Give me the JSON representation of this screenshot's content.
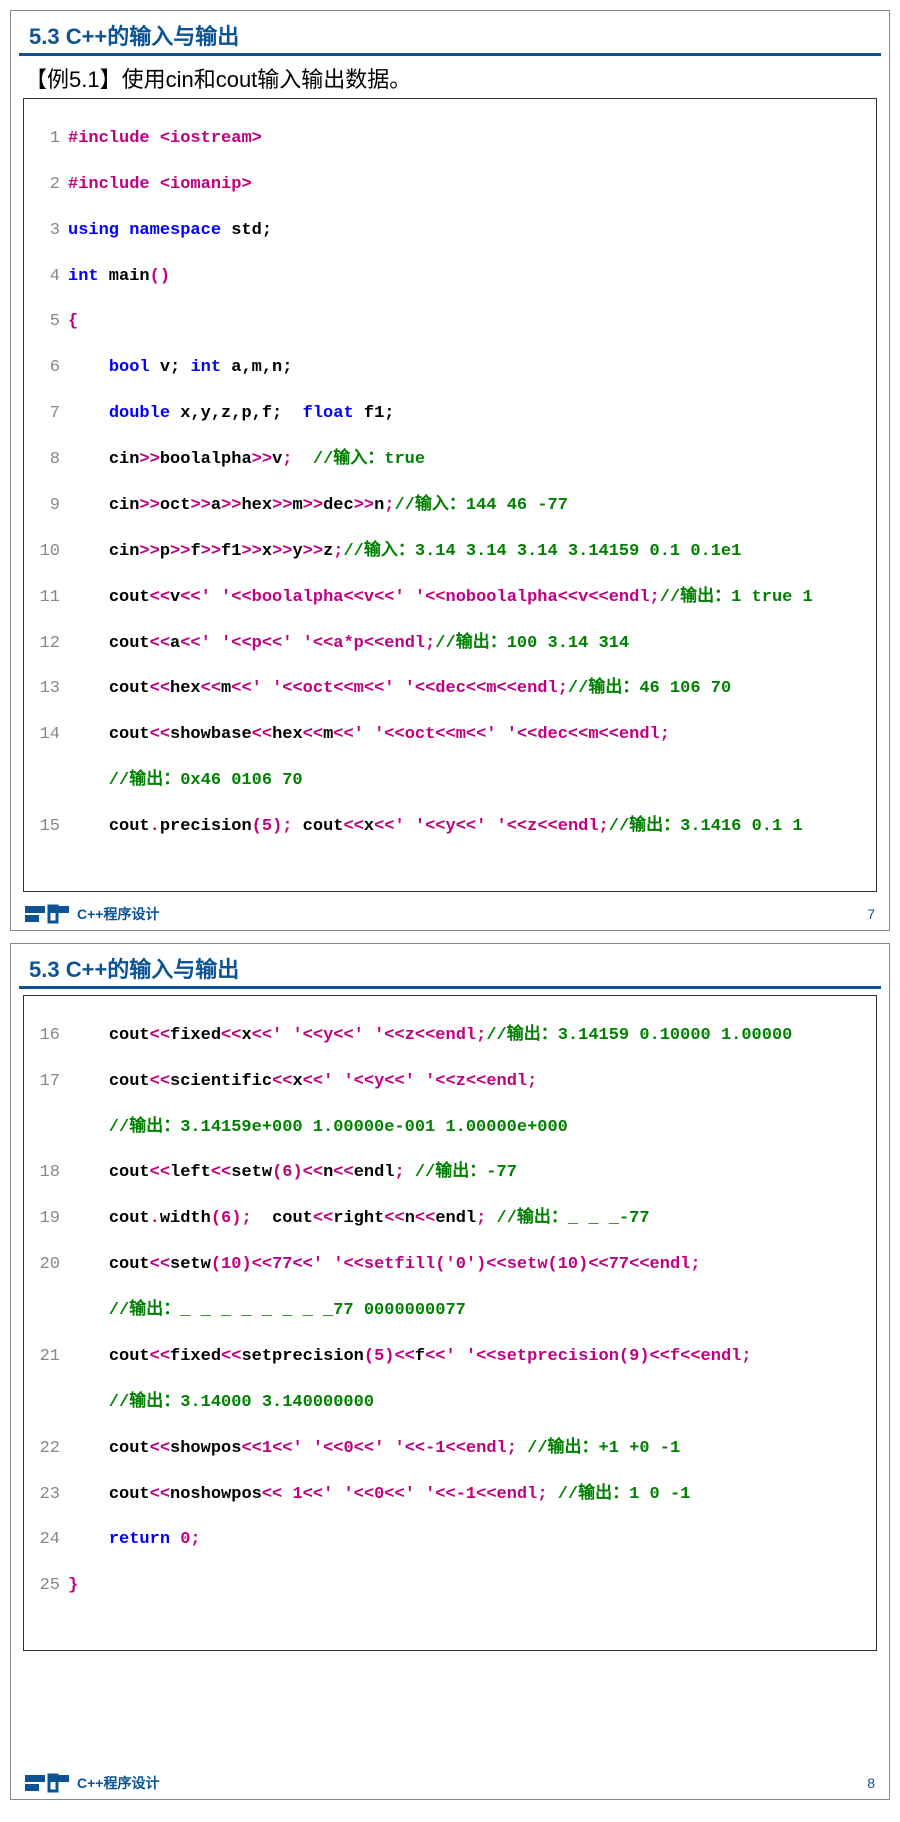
{
  "slide1": {
    "heading": "5.3  C++的输入与输出",
    "example_title": "【例5.1】使用cin和cout输入输出数据。",
    "footer_text": "C++程序设计",
    "page_no": "7",
    "code": {
      "l1": {
        "n": "1",
        "pre": "#include ",
        "hdr": "<iostream>"
      },
      "l2": {
        "n": "2",
        "pre": "#include ",
        "hdr": "<iomanip>"
      },
      "l3": {
        "n": "3",
        "a": "using",
        "b": " namespace ",
        "c": "std",
        "sc": ";"
      },
      "l4": {
        "n": "4",
        "a": "int",
        "b": " main",
        "p": "()"
      },
      "l5": {
        "n": "5",
        "brace": "{"
      },
      "l6": {
        "n": "6",
        "indent": "    ",
        "k1": "bool",
        "t1": " v; ",
        "k2": "int",
        "t2": " a,m,n;"
      },
      "l7": {
        "n": "7",
        "indent": "    ",
        "k1": "double",
        "t1": " x,y,z,p,f;  ",
        "k2": "float",
        "t2": " f1;"
      },
      "l8": {
        "n": "8",
        "indent": "    ",
        "body": "cin>>boolalpha>>v;",
        "cmt": "  //输入：true"
      },
      "l9": {
        "n": "9",
        "indent": "    ",
        "body": "cin>>oct>>a>>hex>>m>>dec>>n;",
        "cmt": "//输入：144 46 -77"
      },
      "l10": {
        "n": "10",
        "indent": "    ",
        "body": "cin>>p>>f>>f1>>x>>y>>z;",
        "cmt": "//输入：3.14 3.14 3.14 3.14159 0.1 0.1e1"
      },
      "l11": {
        "n": "11",
        "indent": "    ",
        "body": "cout<<v<<' '<<boolalpha<<v<<' '<<noboolalpha<<v<<endl;",
        "cmt": "//输出：1 true 1"
      },
      "l12": {
        "n": "12",
        "indent": "    ",
        "body": "cout<<a<<' '<<p<<' '<<a*p<<endl;",
        "cmt": "//输出：100 3.14 314"
      },
      "l13": {
        "n": "13",
        "indent": "    ",
        "body": "cout<<hex<<m<<' '<<oct<<m<<' '<<dec<<m<<endl;",
        "cmt": "//输出：46 106 70"
      },
      "l14": {
        "n": "14",
        "indent": "    ",
        "body": "cout<<showbase<<hex<<m<<' '<<oct<<m<<' '<<dec<<m<<endl;",
        "cmt_below": "    //输出：0x46 0106 70"
      },
      "l15": {
        "n": "15",
        "indent": "    ",
        "body": "cout.precision(5); cout<<x<<' '<<y<<' '<<z<<endl;",
        "cmt": "//输出：3.1416 0.1 1"
      }
    }
  },
  "slide2": {
    "heading": "5.3  C++的输入与输出",
    "footer_text": "C++程序设计",
    "page_no": "8",
    "code": {
      "l16": {
        "n": "16",
        "indent": "    ",
        "body": "cout<<fixed<<x<<' '<<y<<' '<<z<<endl;",
        "cmt": "//输出：3.14159 0.10000 1.00000"
      },
      "l17": {
        "n": "17",
        "indent": "    ",
        "body": "cout<<scientific<<x<<' '<<y<<' '<<z<<endl;",
        "cmt_below": "    //输出：3.14159e+000 1.00000e-001 1.00000e+000"
      },
      "l18": {
        "n": "18",
        "indent": "    ",
        "body": "cout<<left<<setw(6)<<n<<endl;",
        "cmt": " //输出：-77"
      },
      "l19": {
        "n": "19",
        "indent": "    ",
        "body": "cout.width(6);  cout<<right<<n<<endl;",
        "cmt": " //输出：_ _ _-77"
      },
      "l20": {
        "n": "20",
        "indent": "    ",
        "body": "cout<<setw(10)<<77<<' '<<setfill('0')<<setw(10)<<77<<endl;",
        "cmt_below": "    //输出：_ _ _ _ _ _ _ _77 0000000077"
      },
      "l21": {
        "n": "21",
        "indent": "    ",
        "body": "cout<<fixed<<setprecision(5)<<f<<' '<<setprecision(9)<<f<<endl;",
        "cmt_below": "    //输出：3.14000 3.140000000"
      },
      "l22": {
        "n": "22",
        "indent": "    ",
        "body": "cout<<showpos<<1<<' '<<0<<' '<<-1<<endl;",
        "cmt": " //输出：+1 +0 -1"
      },
      "l23": {
        "n": "23",
        "indent": "    ",
        "body": "cout<<noshowpos<< 1<<' '<<0<<' '<<-1<<endl;",
        "cmt": " //输出：1 0 -1"
      },
      "l24": {
        "n": "24",
        "indent": "    ",
        "k": "return",
        "t": " 0;"
      },
      "l25": {
        "n": "25",
        "brace": "}"
      }
    }
  }
}
